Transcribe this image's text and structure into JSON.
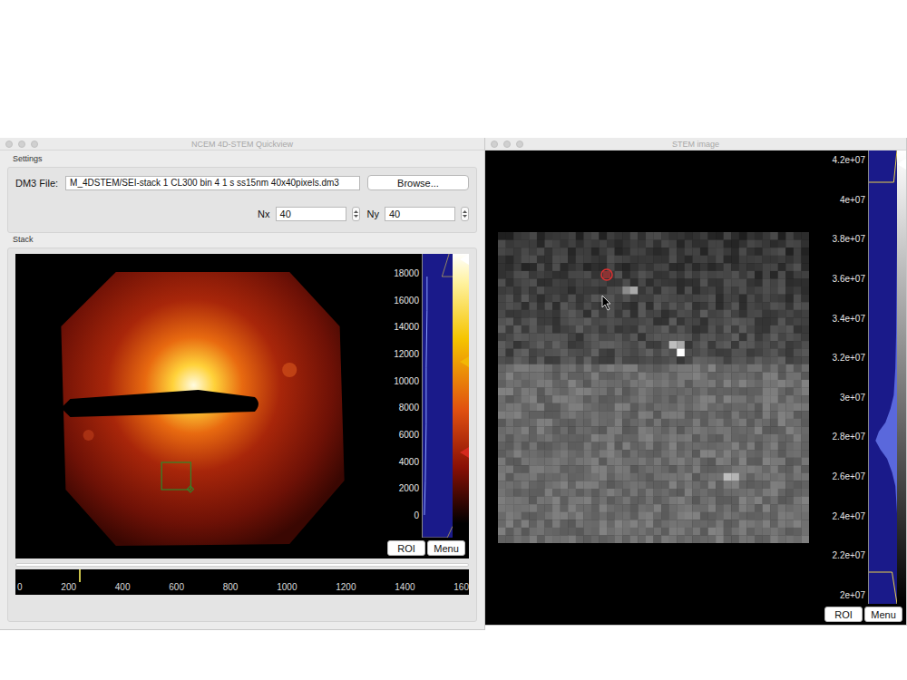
{
  "quickview": {
    "title": "NCEM 4D-STEM Quickview",
    "settings": {
      "label": "Settings",
      "file_label": "DM3 File:",
      "file_value": "M_4DSTEM/SEI-stack 1 CL300 bin 4 1 s ss15nm 40x40pixels.dm3",
      "browse_button": "Browse...",
      "fields": [
        {
          "label": "Nx",
          "value": "40"
        },
        {
          "label": "Ny",
          "value": "40"
        }
      ]
    },
    "stack": {
      "label": "Stack",
      "histogram_ticks": [
        "18000",
        "16000",
        "14000",
        "12000",
        "10000",
        "8000",
        "6000",
        "4000",
        "2000",
        "0"
      ],
      "colorbar_markers": [
        {
          "color": "#ffffff",
          "level": 0.98
        },
        {
          "color": "#f2b705",
          "level": 0.62
        },
        {
          "color": "#d42a1e",
          "level": 0.3
        }
      ],
      "buttons": [
        "ROI",
        "Menu"
      ],
      "frame_slider": {
        "level": 0.13,
        "ticks": [
          "0",
          "200",
          "400",
          "600",
          "800",
          "1000",
          "1200",
          "1400",
          "160"
        ]
      }
    }
  },
  "stem_image": {
    "title": "STEM image",
    "histogram_ticks": [
      "4.2e+07",
      "4e+07",
      "3.8e+07",
      "3.6e+07",
      "3.4e+07",
      "3.2e+07",
      "3e+07",
      "2.8e+07",
      "2.6e+07",
      "2.4e+07",
      "2.2e+07",
      "2e+07"
    ],
    "colorbar_markers": [
      {
        "color": "#ffffff",
        "level": 0.97
      }
    ],
    "buttons": [
      "ROI",
      "Menu"
    ]
  }
}
